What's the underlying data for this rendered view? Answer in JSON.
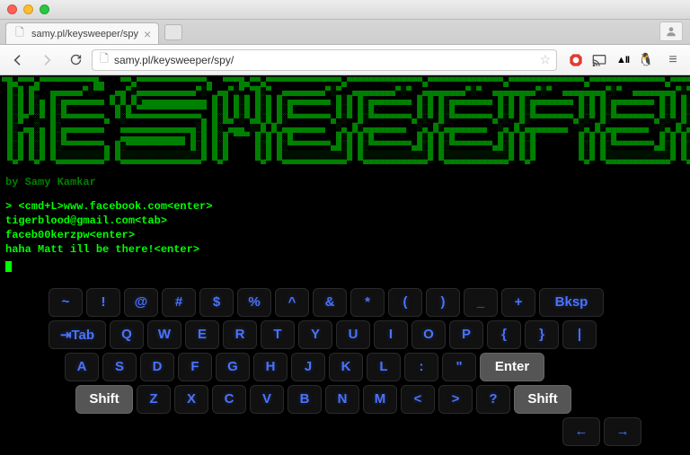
{
  "tab": {
    "title": "samy.pl/keysweeper/spy"
  },
  "url": "samy.pl/keysweeper/spy/",
  "page": {
    "ascii_art": " _    _  _____ __     __ _____  _    _  _____  _____  _____   _____  _____ \n| |  / /|  ___|\\ \\   / //  ___|| |  | ||  ___||  ___||  _  \\ |  ___||  _  \\\n| |_/ / | |__   \\ \\_/ / | (___ | |  | || |__  | |__  | |_| | | |__  | |_| |\n|  _ (  |  __|   \\   /   \\___ \\| |/\\| ||  __| |  __| |  ___/ |  __| |    _/\n| | \\ \\ | |___    | |    ____) |  /\\  || |___ | |___ | |     | |___ | |\\ \\ \n|_|  \\_\\|_____|   |_|   |_____/ \\/  \\/ |_____||_____||_|     |_____||_| \\_\\",
    "byline": "by Samy Kamkar",
    "log": [
      "> <cmd+L>www.facebook.com<enter>",
      "tigerblood@gmail.com<tab>",
      "faceb00kerzpw<enter>",
      "haha Matt ill be there!<enter>"
    ]
  },
  "keyboard": {
    "row1": [
      "~",
      "!",
      "@",
      "#",
      "$",
      "%",
      "^",
      "&",
      "*",
      "(",
      ")",
      "_",
      "+",
      "Bksp"
    ],
    "row2": [
      "⇥Tab",
      "Q",
      "W",
      "E",
      "R",
      "T",
      "Y",
      "U",
      "I",
      "O",
      "P",
      "{",
      "}",
      "|"
    ],
    "row3": [
      "A",
      "S",
      "D",
      "F",
      "G",
      "H",
      "J",
      "K",
      "L",
      ":",
      "\"",
      "Enter"
    ],
    "row4": [
      "Shift",
      "Z",
      "X",
      "C",
      "V",
      "B",
      "N",
      "M",
      "<",
      ">",
      "?",
      "Shift"
    ],
    "row5": [
      "←",
      "→"
    ]
  }
}
